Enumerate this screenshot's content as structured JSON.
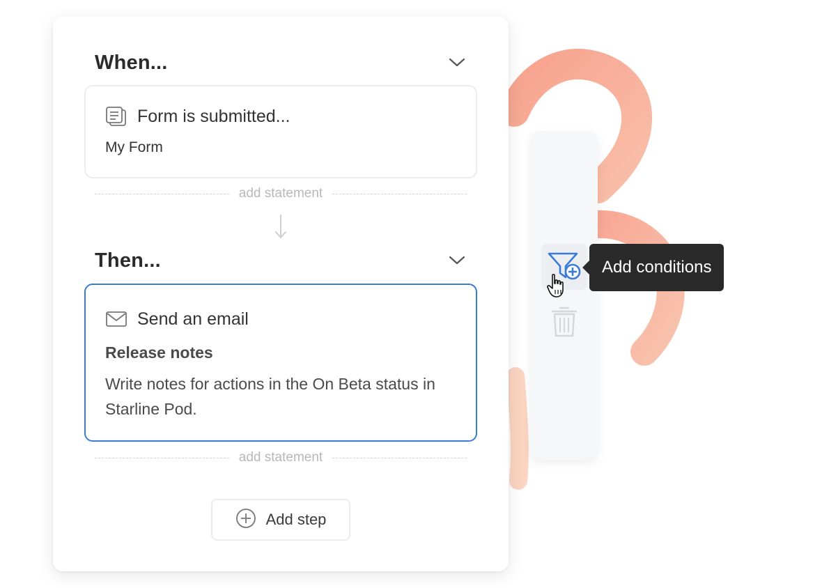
{
  "when_section": {
    "title": "When...",
    "trigger": {
      "icon": "form-document-icon",
      "title": "Form is submitted...",
      "subtitle": "My Form"
    },
    "add_statement_label": "add statement"
  },
  "then_section": {
    "title": "Then...",
    "action": {
      "icon": "envelope-icon",
      "title": "Send an email",
      "name": "Release notes",
      "description": "Write notes for actions in the On Beta status in Starline Pod."
    },
    "add_statement_label": "add statement"
  },
  "add_step": {
    "icon": "plus-circle-icon",
    "label": "Add step"
  },
  "toolbar": {
    "items": [
      {
        "icon": "filter-add-icon",
        "tooltip": "Add conditions",
        "state": "hover"
      },
      {
        "icon": "trash-icon",
        "state": "disabled"
      }
    ]
  },
  "colors": {
    "accent": "#3a7bd5",
    "ribbon": "#f6927a",
    "tooltip_bg": "#2a2a2a"
  }
}
